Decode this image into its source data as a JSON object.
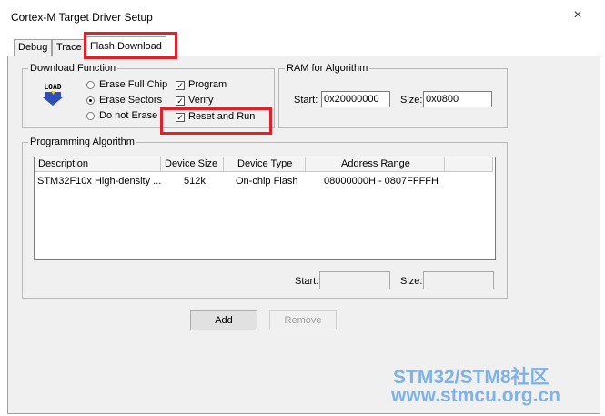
{
  "window": {
    "title": "Cortex-M Target Driver Setup",
    "close_glyph": "×"
  },
  "tabs": [
    {
      "label": "Debug"
    },
    {
      "label": "Trace"
    },
    {
      "label": "Flash Download"
    }
  ],
  "download_function": {
    "label": "Download Function",
    "icon_text": "LOAD",
    "erase_options": [
      {
        "label": "Erase Full Chip",
        "selected": false
      },
      {
        "label": "Erase Sectors",
        "selected": true
      },
      {
        "label": "Do not Erase",
        "selected": false
      }
    ],
    "checks": [
      {
        "label": "Program",
        "checked": true
      },
      {
        "label": "Verify",
        "checked": true
      },
      {
        "label": "Reset and Run",
        "checked": true
      }
    ]
  },
  "ram_for_algorithm": {
    "label": "RAM for Algorithm",
    "start_label": "Start:",
    "start_value": "0x20000000",
    "size_label": "Size:",
    "size_value": "0x0800"
  },
  "programming_algorithm": {
    "label": "Programming Algorithm",
    "columns": [
      "Description",
      "Device Size",
      "Device Type",
      "Address Range"
    ],
    "rows": [
      [
        "STM32F10x High-density ...",
        "512k",
        "On-chip Flash",
        "08000000H - 0807FFFFH"
      ]
    ],
    "start_label": "Start:",
    "start_value": "",
    "size_label": "Size:",
    "size_value": ""
  },
  "buttons": {
    "add": "Add",
    "remove": "Remove"
  },
  "watermark": {
    "line1": "STM32/STM8社区",
    "line2": "www.stmcu.org.cn"
  },
  "colors": {
    "highlight": "#e0202a",
    "watermark": "#7fb2e5"
  }
}
